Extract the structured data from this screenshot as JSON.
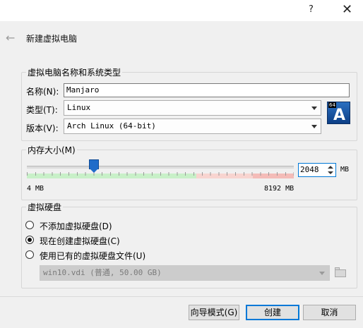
{
  "window": {
    "help_label": "?",
    "close_label": "✕"
  },
  "wizard": {
    "back_label": "←",
    "title": "新建虚拟电脑"
  },
  "name_os": {
    "group_title": "虚拟电脑名称和系统类型",
    "name_label": "名称(N):",
    "name_value": "Manjaro",
    "type_label": "类型(T):",
    "type_value": "Linux",
    "version_label": "版本(V):",
    "version_value": "Arch Linux (64-bit)",
    "os_icon": {
      "name": "arch-linux-64-icon",
      "bits": "64",
      "letter": "A"
    }
  },
  "memory": {
    "group_title": "内存大小(M)",
    "value": "2048",
    "unit": "MB",
    "min_label": "4 MB",
    "max_label": "8192 MB",
    "min": 4,
    "max": 8192,
    "current": 2048
  },
  "disk": {
    "group_title": "虚拟硬盘",
    "options": [
      {
        "label": "不添加虚拟硬盘(D)",
        "checked": false
      },
      {
        "label": "现在创建虚拟硬盘(C)",
        "checked": true
      },
      {
        "label": "使用已有的虚拟硬盘文件(U)",
        "checked": false
      }
    ],
    "existing_file": "win10.vdi (普通, 50.00 GB)"
  },
  "footer": {
    "guided_label": "向导模式(G)",
    "create_label": "创建",
    "cancel_label": "取消"
  },
  "colors": {
    "accent": "#0078d7",
    "slider_thumb": "#1f6cc9",
    "range_ok": "#c8f0c8",
    "range_warn": "#f8d4d0"
  }
}
